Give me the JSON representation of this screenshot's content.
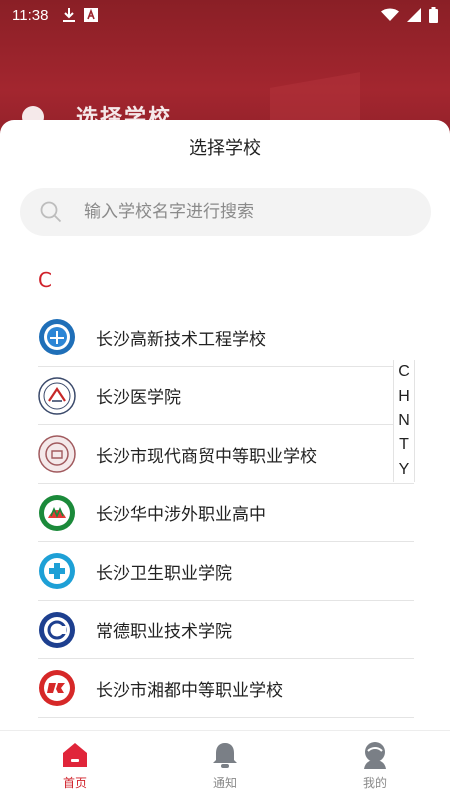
{
  "status_bar": {
    "time": "11:38"
  },
  "background": {
    "title": "选择学校"
  },
  "sheet": {
    "title": "选择学校",
    "search": {
      "placeholder": "输入学校名字进行搜索",
      "value": ""
    },
    "section_letter": "C",
    "schools": [
      {
        "name": "长沙高新技术工程学校",
        "logo_icon": "school-emblem-blue"
      },
      {
        "name": "长沙医学院",
        "logo_icon": "school-emblem-cam"
      },
      {
        "name": "长沙市现代商贸中等职业学校",
        "logo_icon": "school-emblem-brown"
      },
      {
        "name": "长沙华中涉外职业高中",
        "logo_icon": "school-emblem-green"
      },
      {
        "name": "长沙卫生职业学院",
        "logo_icon": "school-emblem-cross"
      },
      {
        "name": "常德职业技术学院",
        "logo_icon": "school-emblem-navy"
      },
      {
        "name": "长沙市湘都中等职业学校",
        "logo_icon": "school-emblem-red"
      }
    ],
    "index_letters": [
      "C",
      "H",
      "N",
      "T",
      "Y"
    ]
  },
  "bottom_nav": {
    "items": [
      {
        "label": "首页",
        "icon": "home-icon",
        "active": true
      },
      {
        "label": "通知",
        "icon": "bell-icon",
        "active": false
      },
      {
        "label": "我的",
        "icon": "profile-icon",
        "active": false
      }
    ]
  },
  "colors": {
    "accent": "#d0212a",
    "header": "#9b232c"
  }
}
